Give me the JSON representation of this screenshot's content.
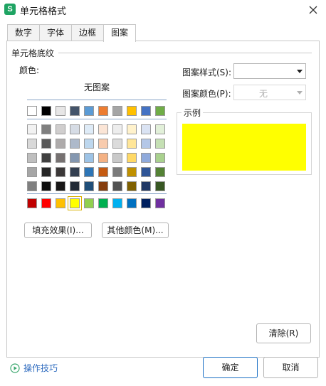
{
  "window": {
    "app_icon_letter": "S",
    "title": "单元格格式"
  },
  "tabs": [
    {
      "label": "数字",
      "active": false
    },
    {
      "label": "字体",
      "active": false
    },
    {
      "label": "边框",
      "active": false
    },
    {
      "label": "图案",
      "active": true
    }
  ],
  "shading": {
    "section_title": "单元格底纹",
    "color_label": "颜色:",
    "no_pattern_label": "无图案",
    "theme_row": [
      "#ffffff",
      "#000000",
      "#e7e6e6",
      "#44546a",
      "#5b9bd5",
      "#ed7d31",
      "#a5a5a5",
      "#ffc000",
      "#4472c4",
      "#70ad47"
    ],
    "shade_rows": [
      [
        "#f2f2f2",
        "#7f7f7f",
        "#d0cece",
        "#d6dce5",
        "#deebf7",
        "#fbe5d6",
        "#ededed",
        "#fff2cc",
        "#dae3f3",
        "#e2f0d9"
      ],
      [
        "#d9d9d9",
        "#595959",
        "#aeabab",
        "#adb9ca",
        "#bdd7ee",
        "#f8cbad",
        "#dbdbdb",
        "#ffe699",
        "#b4c7e7",
        "#c5e0b4"
      ],
      [
        "#bfbfbf",
        "#404040",
        "#767171",
        "#8497b0",
        "#9dc3e6",
        "#f4b183",
        "#c9c9c9",
        "#ffd966",
        "#8faadc",
        "#a9d18e"
      ],
      [
        "#a6a6a6",
        "#262626",
        "#3b3838",
        "#333f50",
        "#2e75b6",
        "#c55a11",
        "#7b7b7b",
        "#bf9000",
        "#2f5597",
        "#548235"
      ],
      [
        "#808080",
        "#0d0d0d",
        "#171616",
        "#222a35",
        "#1f4e79",
        "#843c0c",
        "#525252",
        "#7f6000",
        "#203864",
        "#385723"
      ]
    ],
    "standard_row": [
      "#c00000",
      "#ff0000",
      "#ffc000",
      "#ffff00",
      "#92d050",
      "#00b050",
      "#00b0f0",
      "#0070c0",
      "#002060",
      "#7030a0"
    ],
    "selected_color": "#ffff00",
    "fill_effects_button": "填充效果(I)...",
    "more_colors_button": "其他颜色(M)..."
  },
  "pattern": {
    "style_label": "图案样式(S):",
    "style_value": "",
    "color_label": "图案颜色(P):",
    "color_value": "无"
  },
  "sample": {
    "label": "示例",
    "fill_color": "#ffff00"
  },
  "footer": {
    "clear_button": "清除(R)",
    "help_link": "操作技巧",
    "ok_button": "确定",
    "cancel_button": "取消"
  }
}
